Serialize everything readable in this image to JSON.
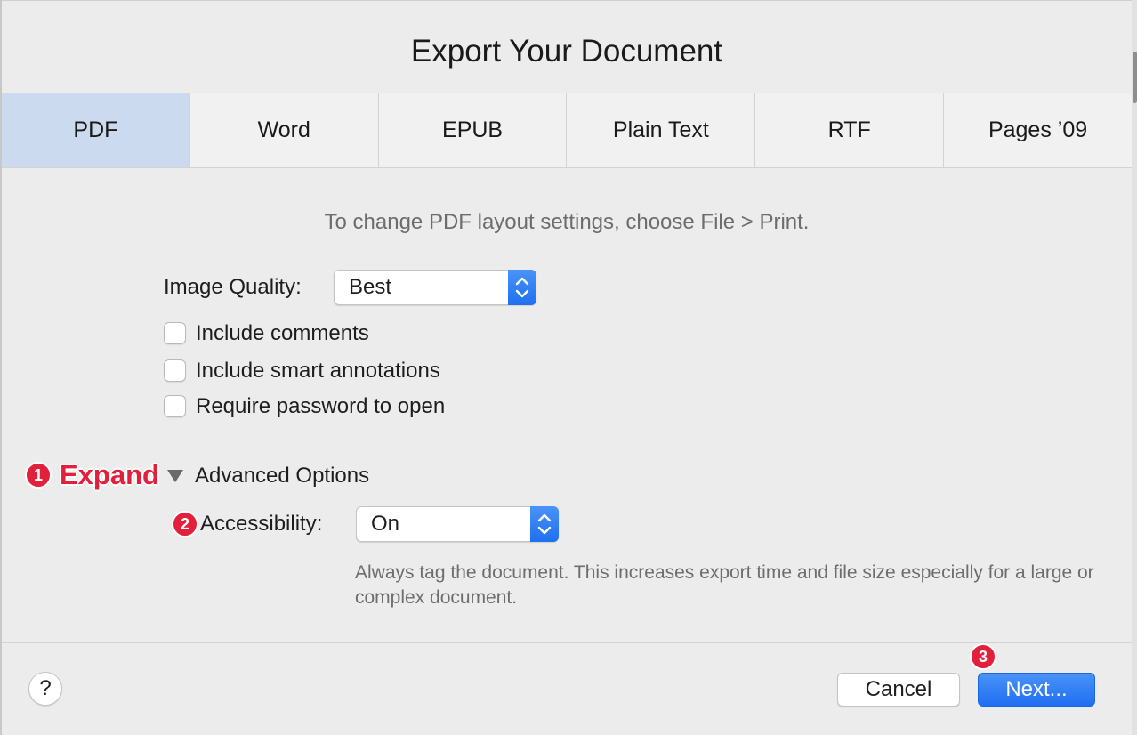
{
  "dialog": {
    "title": "Export Your Document"
  },
  "tabs": [
    {
      "label": "PDF",
      "selected": true
    },
    {
      "label": "Word",
      "selected": false
    },
    {
      "label": "EPUB",
      "selected": false
    },
    {
      "label": "Plain Text",
      "selected": false
    },
    {
      "label": "RTF",
      "selected": false
    },
    {
      "label": "Pages ’09",
      "selected": false
    }
  ],
  "pdf": {
    "hint": "To change PDF layout settings, choose File > Print.",
    "image_quality_label": "Image Quality:",
    "image_quality_value": "Best",
    "checkboxes": [
      {
        "label": "Include comments",
        "checked": false
      },
      {
        "label": "Include smart annotations",
        "checked": false
      },
      {
        "label": "Require password to open",
        "checked": false
      }
    ],
    "advanced_label": "Advanced Options",
    "accessibility_label": "Accessibility:",
    "accessibility_value": "On",
    "accessibility_note": "Always tag the document. This increases export time and file size especially for a large or complex document."
  },
  "annotations": {
    "step1_number": "1",
    "step1_text": "Expand",
    "step2_number": "2",
    "step3_number": "3"
  },
  "footer": {
    "help_label": "?",
    "cancel_label": "Cancel",
    "next_label": "Next..."
  },
  "icons": {
    "disclosure": "disclosure-triangle-expanded-icon",
    "stepper": "up-down-chevron-icon"
  },
  "colors": {
    "accent": "#1f6ff0",
    "selected_tab": "#cbdaee",
    "annotation": "#e2203c"
  }
}
